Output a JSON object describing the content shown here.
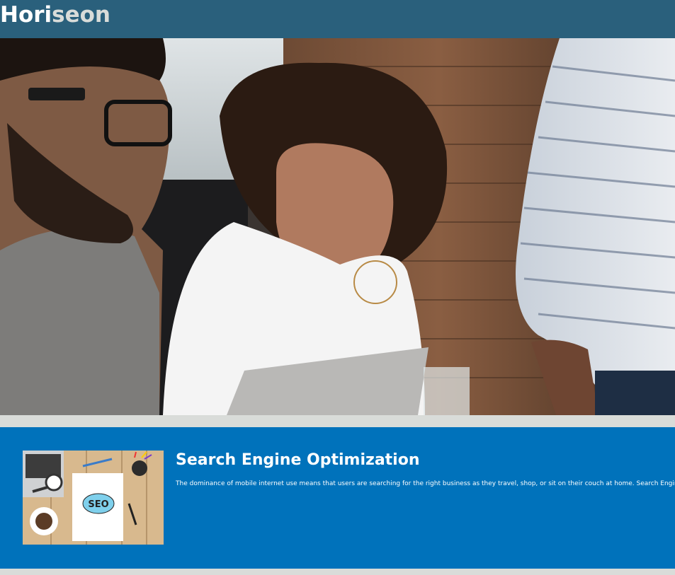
{
  "header": {
    "logo_main": "Hori",
    "logo_accent": "seon"
  },
  "hero": {
    "image": "people-at-laptop-photo"
  },
  "sections": [
    {
      "id": "search-engine-optimization",
      "image": "seo-desk-illustration",
      "image_text": "SEO",
      "title": "Search Engine Optimization",
      "text": "The dominance of mobile internet use means that users are searching for the right business as they travel, shop, or sit on their couch at home. Search Engine Optimization"
    }
  ],
  "colors": {
    "header_bg": "#2a607c",
    "accent_text": "#d9dcd9",
    "page_bg": "#d9dcd9",
    "section_bg": "#0072bb"
  }
}
